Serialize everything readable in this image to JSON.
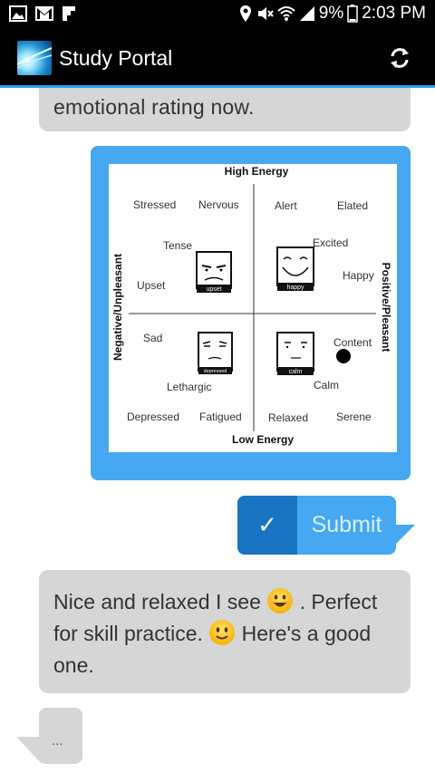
{
  "status_bar": {
    "battery": "9%",
    "time": "2:03 PM",
    "icons": [
      "image-icon",
      "gmail-icon",
      "flipboard-icon",
      "location-icon",
      "mute-icon",
      "wifi-icon",
      "signal-icon",
      "battery-icon"
    ]
  },
  "app_bar": {
    "title": "Study Portal",
    "refresh_icon": "refresh-icon"
  },
  "chat": {
    "prev_bot_partial": "emotional rating now.",
    "mood_grid": {
      "top_label": "High Energy",
      "bottom_label": "Low Energy",
      "left_label": "Negative/Unpleasant",
      "right_label": "Positive/Pleasant",
      "words": {
        "stressed": "Stressed",
        "nervous": "Nervous",
        "alert": "Alert",
        "elated": "Elated",
        "tense": "Tense",
        "excited": "Excited",
        "upset": "Upset",
        "happy": "Happy",
        "sad": "Sad",
        "content": "Content",
        "lethargic": "Lethargic",
        "calm": "Calm",
        "depressed": "Depressed",
        "fatigued": "Fatigued",
        "relaxed": "Relaxed",
        "serene": "Serene"
      },
      "face_labels": {
        "upset": "upset",
        "happy": "happy",
        "depressed": "depressed",
        "calm": "calm"
      }
    },
    "submit": {
      "check": "✓",
      "label": "Submit"
    },
    "bot_message": {
      "part1": "Nice and relaxed I see ",
      "part2": " . Perfect for skill practice. ",
      "part3": " Here's a good one."
    },
    "typing": "..."
  }
}
